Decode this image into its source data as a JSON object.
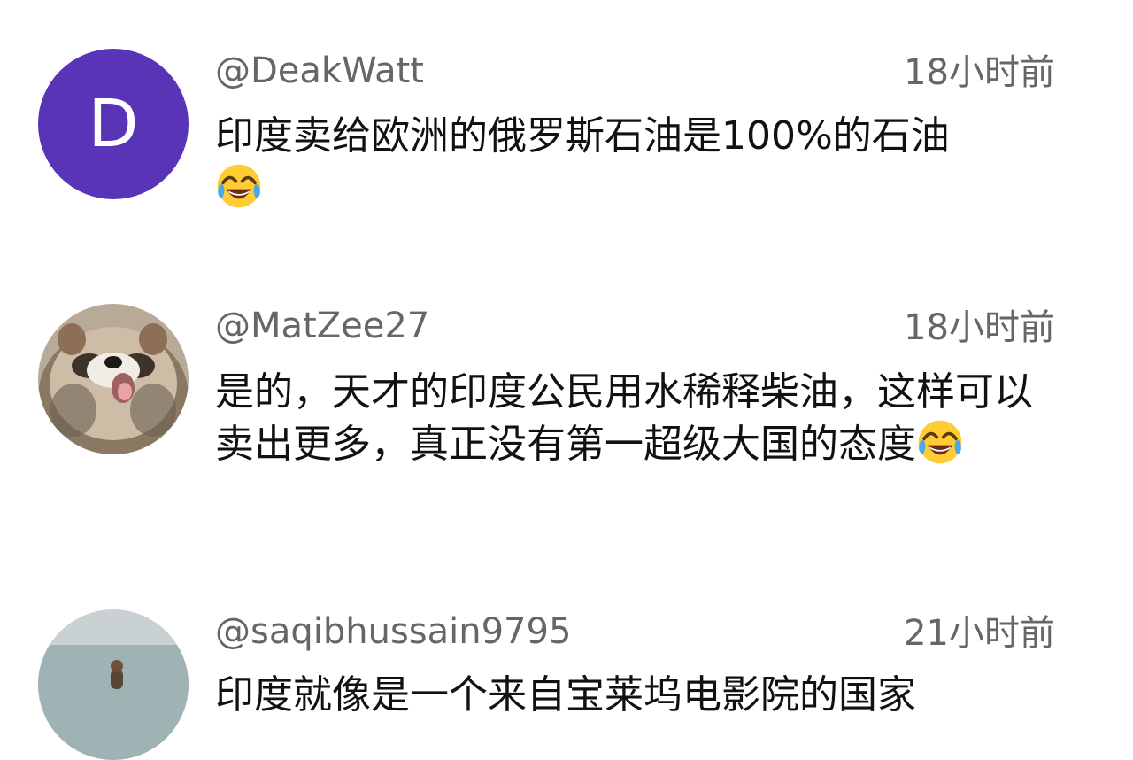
{
  "comments": [
    {
      "avatar_letter": "D",
      "avatar_color": "#5a34b6",
      "username": "@DeakWatt",
      "time": "18小时前",
      "text": "印度卖给欧洲的俄罗斯石油是100%的石油",
      "emoji": "face-with-tears-of-joy"
    },
    {
      "avatar_icon": "raccoon-dog-photo",
      "username": "@MatZee27",
      "time": "18小时前",
      "text": "是的，天才的印度公民用水稀释柴油，这样可以卖出更多，真正没有第一超级大国的态度",
      "emoji": "face-with-tears-of-joy"
    },
    {
      "avatar_icon": "beach-person-photo",
      "username": "@saqibhussain9795",
      "time": "21小时前",
      "text": "印度就像是一个来自宝莱坞电影院的国家"
    }
  ]
}
